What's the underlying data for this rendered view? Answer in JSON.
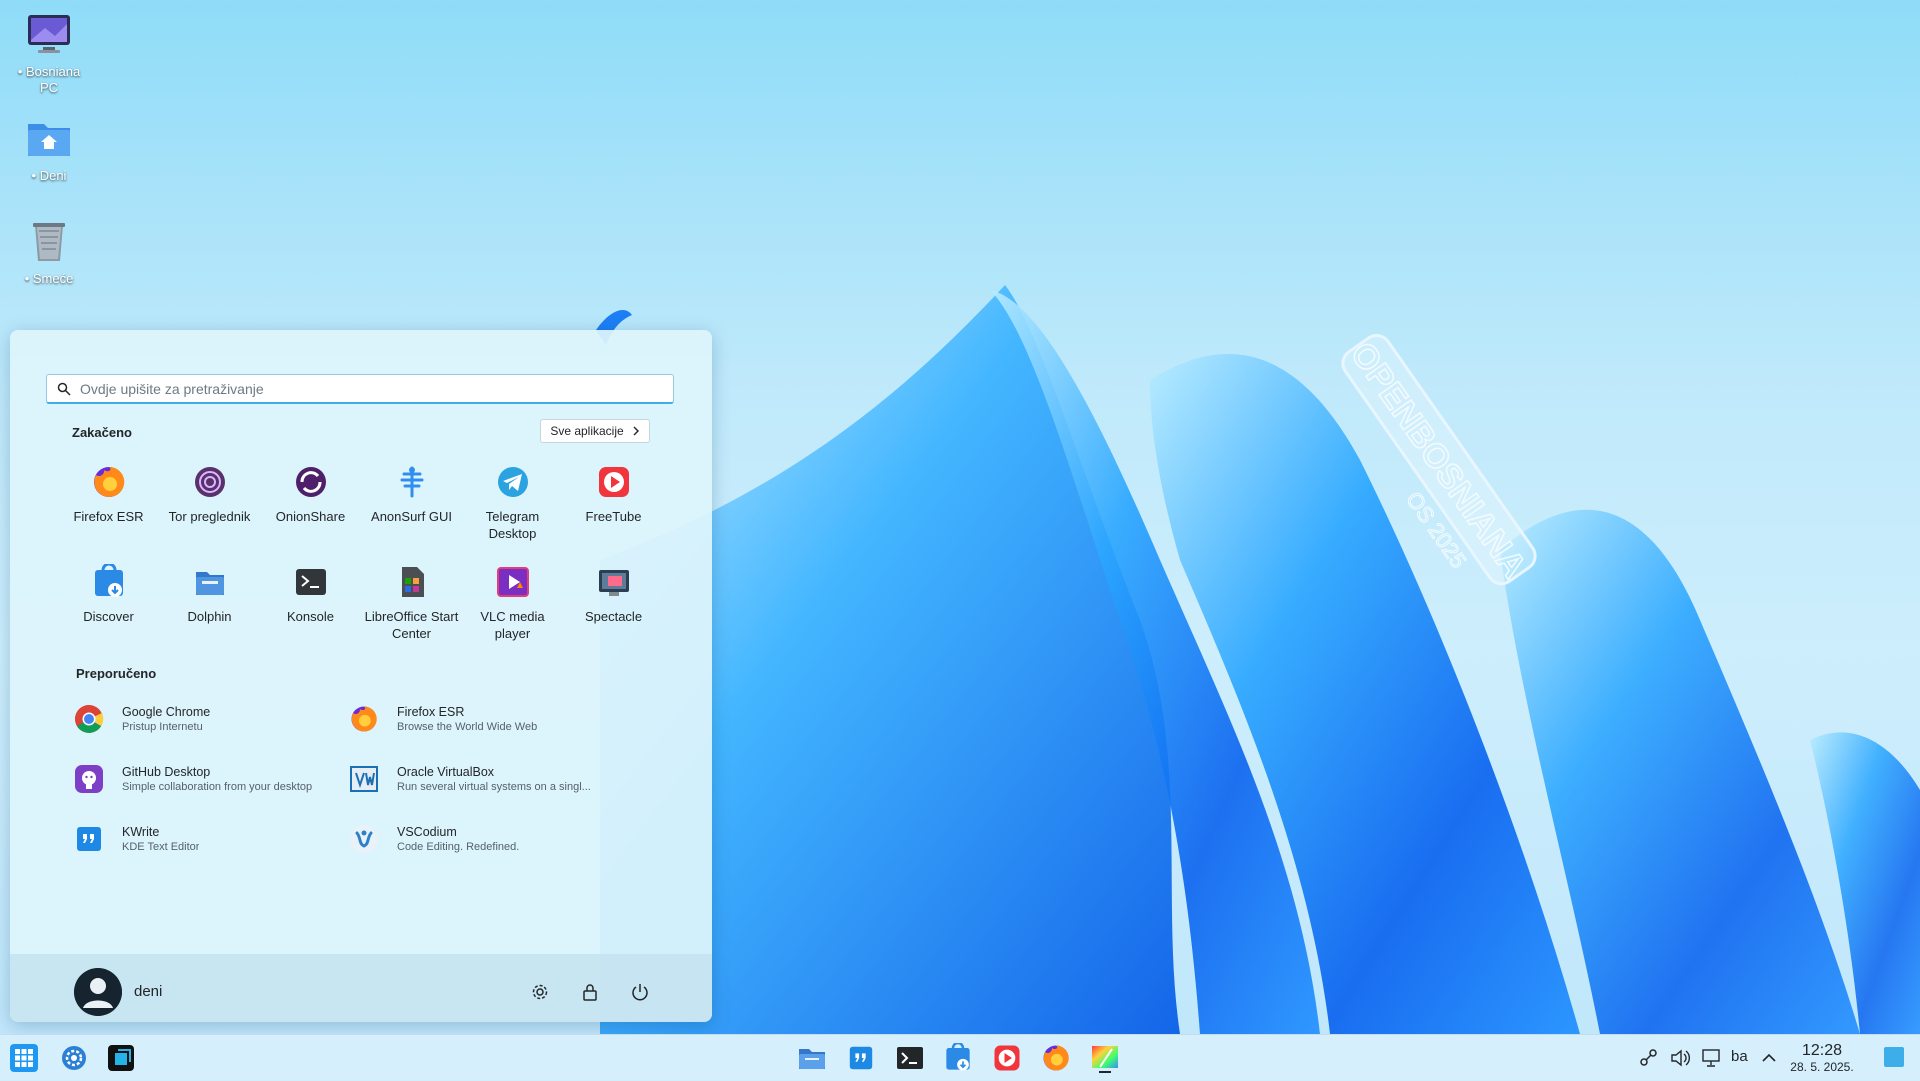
{
  "desktop": {
    "icons": [
      {
        "label": "• Bosniana PC",
        "icon": "computer-icon"
      },
      {
        "label": "• Deni",
        "icon": "home-folder-icon"
      },
      {
        "label": "• Smeće",
        "icon": "trash-icon"
      }
    ],
    "wallpaper_text": "OPENBOSNIANA OS 2025"
  },
  "menu": {
    "search": {
      "placeholder": "Ovdje upišite za pretraživanje",
      "value": ""
    },
    "pinned_title": "Zakačeno",
    "all_apps_label": "Sve aplikacije",
    "pinned": [
      {
        "label": "Firefox ESR",
        "icon": "firefox-icon"
      },
      {
        "label": "Tor preglednik",
        "icon": "tor-browser-icon"
      },
      {
        "label": "OnionShare",
        "icon": "onionshare-icon"
      },
      {
        "label": "AnonSurf GUI",
        "icon": "anonsurf-icon"
      },
      {
        "label": "Telegram Desktop",
        "icon": "telegram-icon"
      },
      {
        "label": "FreeTube",
        "icon": "freetube-icon"
      },
      {
        "label": "Discover",
        "icon": "discover-icon"
      },
      {
        "label": "Dolphin",
        "icon": "dolphin-icon"
      },
      {
        "label": "Konsole",
        "icon": "konsole-icon"
      },
      {
        "label": "LibreOffice Start Center",
        "icon": "libreoffice-icon"
      },
      {
        "label": "VLC media player",
        "icon": "vlc-icon"
      },
      {
        "label": "Spectacle",
        "icon": "spectacle-icon"
      }
    ],
    "recommended_title": "Preporučeno",
    "recommended": [
      {
        "name": "Google Chrome",
        "desc": "Pristup Internetu",
        "icon": "chrome-icon"
      },
      {
        "name": "Firefox ESR",
        "desc": "Browse the World Wide Web",
        "icon": "firefox-icon"
      },
      {
        "name": "GitHub Desktop",
        "desc": "Simple collaboration from your desktop",
        "icon": "github-icon"
      },
      {
        "name": "Oracle VirtualBox",
        "desc": "Run several virtual systems on a singl...",
        "icon": "virtualbox-icon"
      },
      {
        "name": "KWrite",
        "desc": "KDE Text Editor",
        "icon": "kwrite-icon"
      },
      {
        "name": "VSCodium",
        "desc": "Code Editing. Redefined.",
        "icon": "vscodium-icon"
      }
    ],
    "user": {
      "name": "deni"
    },
    "footer_buttons": [
      "settings-icon",
      "lock-icon",
      "power-icon"
    ]
  },
  "taskbar": {
    "left": [
      "app-launcher-icon",
      "system-settings-icon",
      "virtualbox-icon"
    ],
    "center": [
      "file-manager-icon",
      "kwrite-icon",
      "terminal-icon",
      "discover-icon",
      "freetube-icon",
      "firefox-icon",
      "color-app-icon"
    ],
    "tray": [
      "network-share-icon",
      "volume-icon",
      "network-icon"
    ],
    "keyboard_layout": "ba",
    "time": "12:28",
    "date": "28. 5. 2025.",
    "accent": "#3daee9"
  }
}
